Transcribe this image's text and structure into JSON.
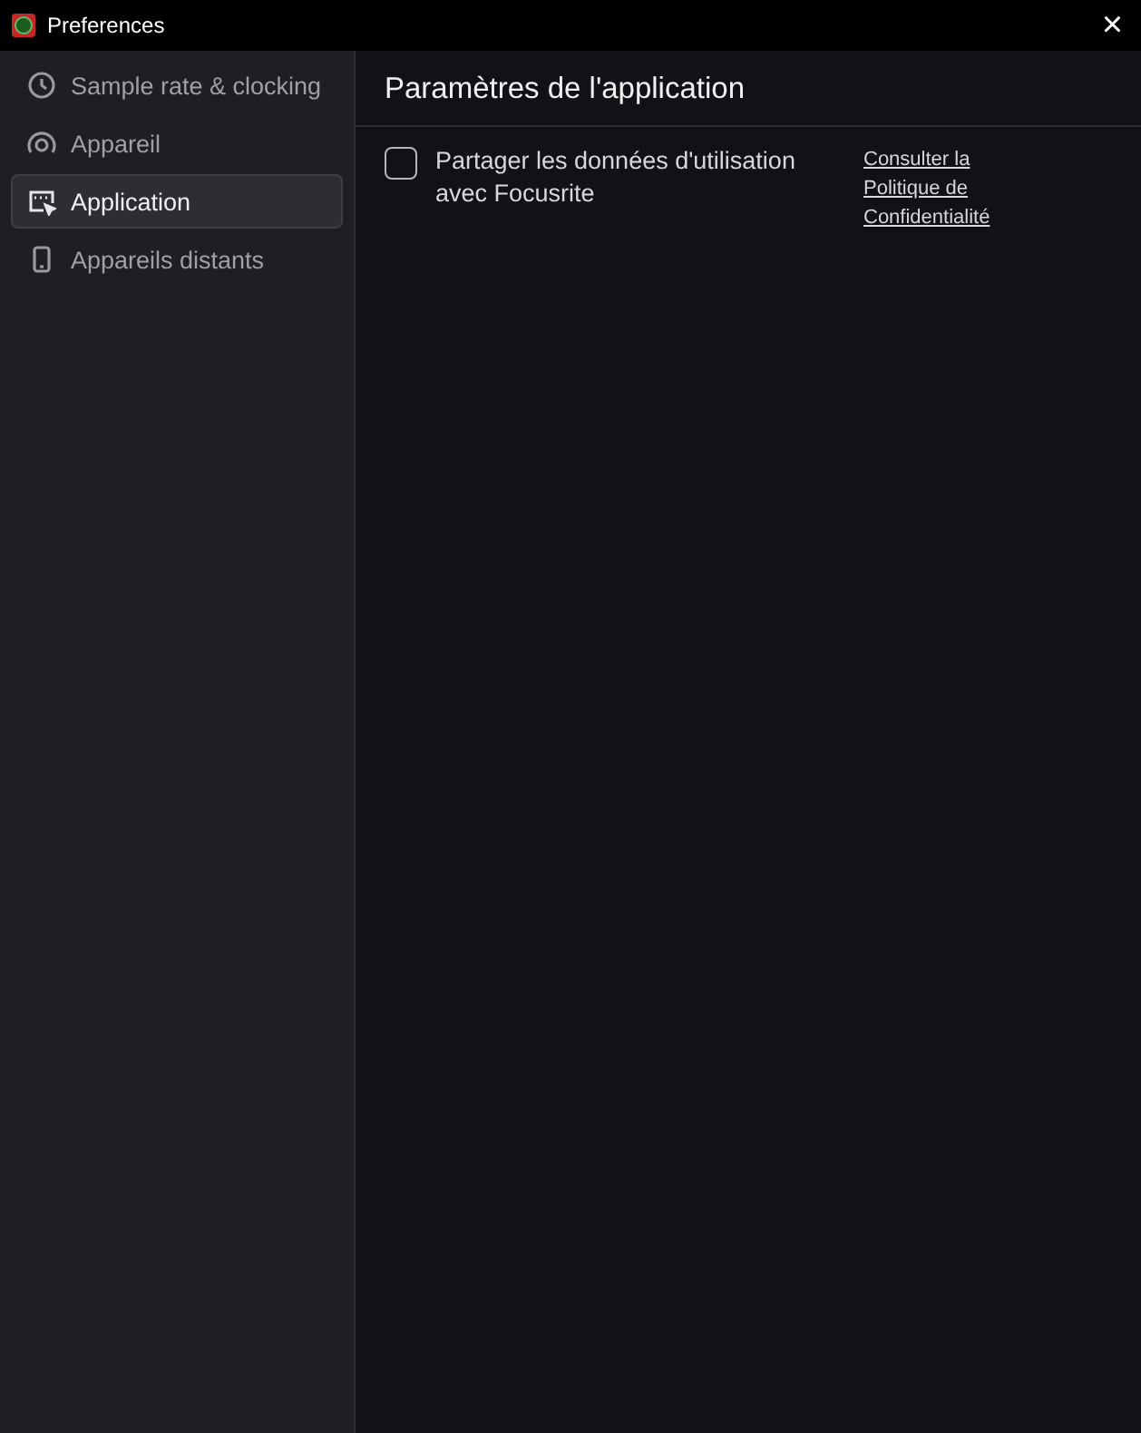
{
  "window": {
    "title": "Preferences",
    "close": "×"
  },
  "sidebar": {
    "items": [
      {
        "label": "Sample rate & clocking",
        "selected": false
      },
      {
        "label": "Appareil",
        "selected": false
      },
      {
        "label": "Application",
        "selected": true
      },
      {
        "label": "Appareils distants",
        "selected": false
      }
    ]
  },
  "main": {
    "title": "Paramètres de l'application",
    "option": {
      "label": "Partager les données d'utilisation avec Focusrite",
      "checked": false
    },
    "link": "Consulter la Politique de Confidentialité"
  }
}
